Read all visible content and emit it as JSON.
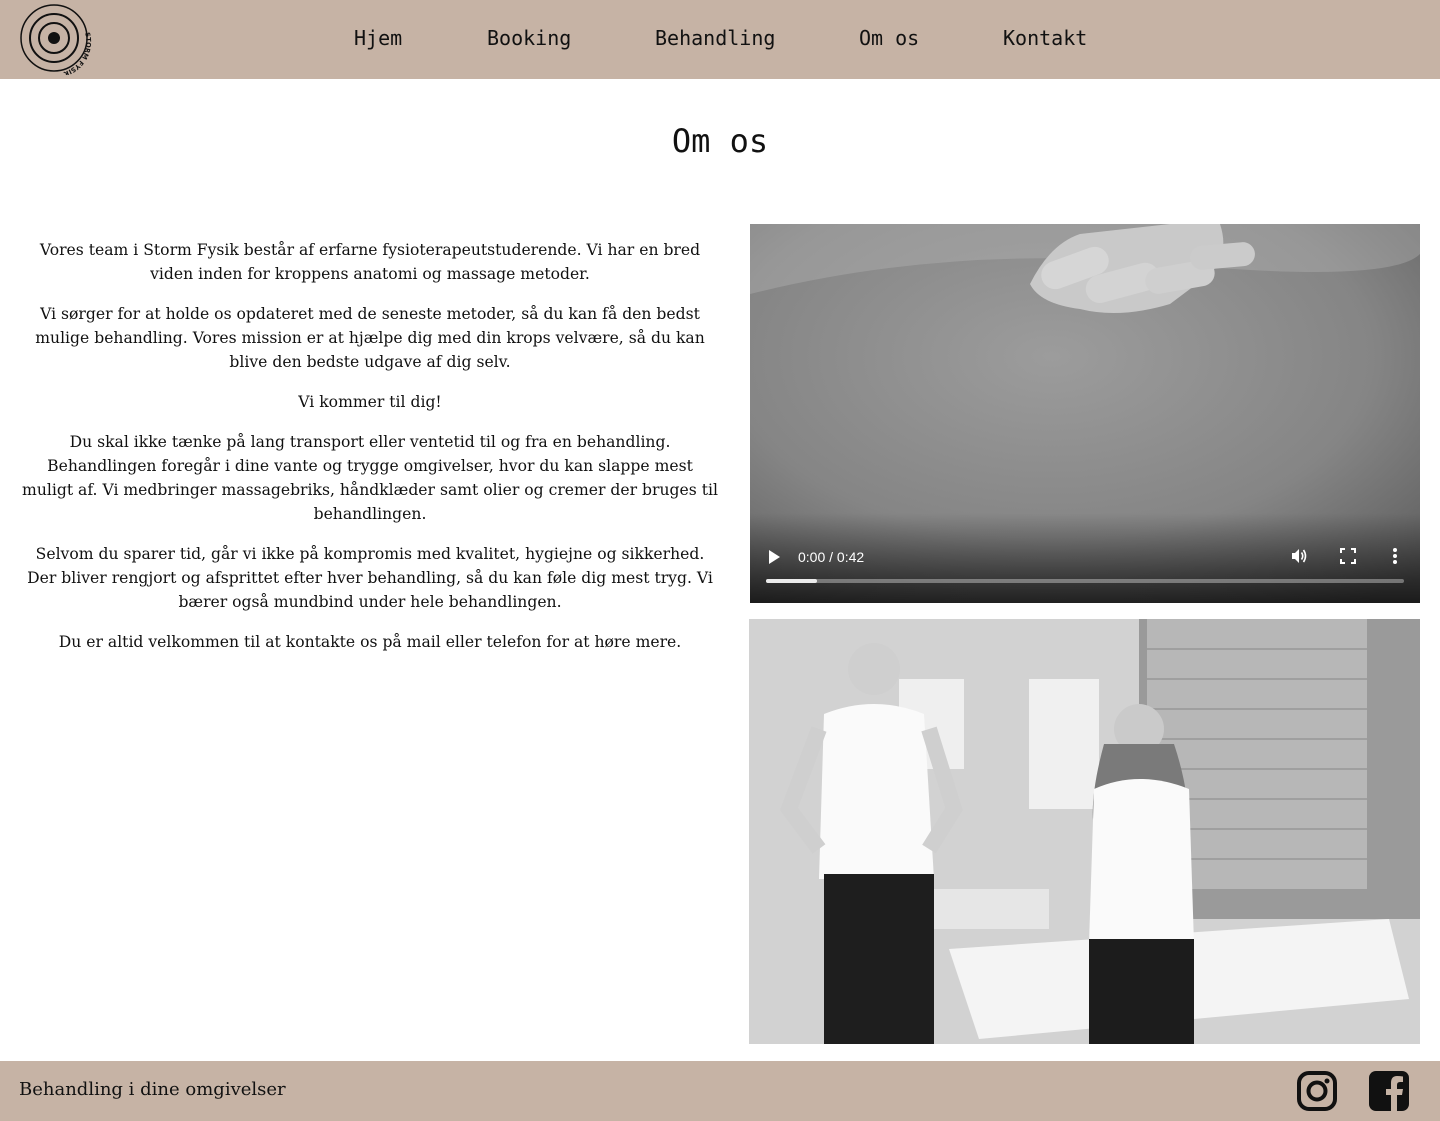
{
  "brand": {
    "logo_text": "STORM FYSIK"
  },
  "nav": {
    "items": [
      {
        "label": "Hjem"
      },
      {
        "label": "Booking"
      },
      {
        "label": "Behandling"
      },
      {
        "label": "Om os"
      },
      {
        "label": "Kontakt"
      }
    ]
  },
  "page": {
    "title": "Om os"
  },
  "content": {
    "paragraphs": [
      "Vores team i Storm Fysik består af erfarne fysioterapeutstuderende. Vi har en bred viden inden for kroppens anatomi og massage metoder.",
      "Vi sørger for at holde os opdateret med de seneste metoder, så du kan få den bedst mulige behandling. Vores mission er at hjælpe dig med din krops velvære, så du kan blive den bedste udgave af dig selv.",
      "Vi kommer til dig!",
      "Du skal ikke tænke på lang transport eller ventetid til og fra en behandling. Behandlingen foregår i dine vante og trygge omgivelser, hvor du kan slappe mest muligt af. Vi medbringer massagebriks, håndklæder samt olier og cremer der bruges til behandlingen.",
      "Selvom du sparer tid, går vi ikke på kompromis med kvalitet, hygiejne og sikkerhed. Der bliver rengjort og afsprittet efter hver behandling, så du kan føle dig mest tryg. Vi bærer også mundbind under hele behandlingen.",
      "Du er altid velkommen til at kontakte os på mail eller telefon for at høre mere."
    ]
  },
  "video": {
    "time_display": "0:00 / 0:42",
    "buffered_fraction": 0.08,
    "controls": [
      "play-icon",
      "volume-icon",
      "fullscreen-icon",
      "more-options-icon"
    ]
  },
  "footer": {
    "tagline": "Behandling i dine omgivelser",
    "social": [
      "instagram-icon",
      "facebook-icon"
    ]
  }
}
